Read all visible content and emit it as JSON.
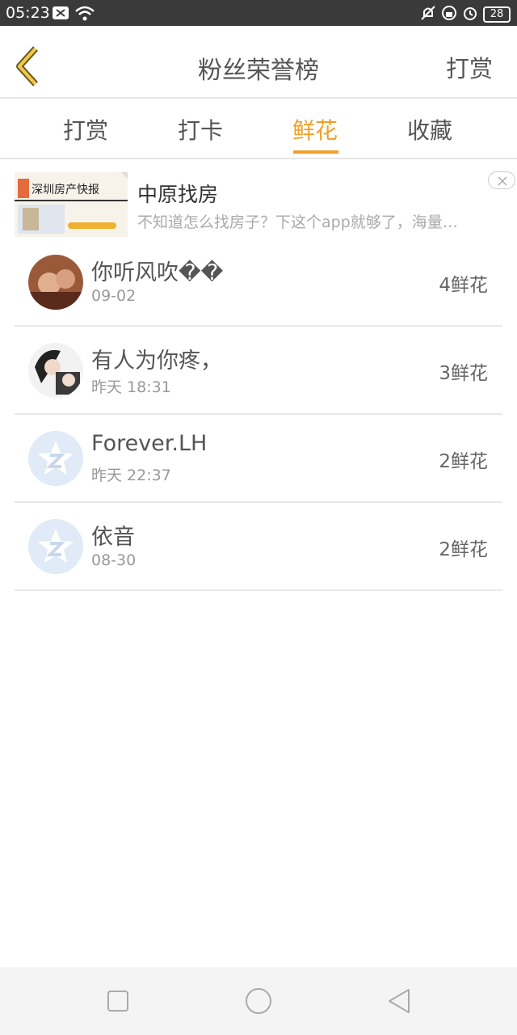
{
  "status": {
    "time": "05:23",
    "battery": "28"
  },
  "header": {
    "title": "粉丝荣誉榜",
    "action": "打赏"
  },
  "tabs": [
    {
      "label": "打赏"
    },
    {
      "label": "打卡"
    },
    {
      "label": "鲜花"
    },
    {
      "label": "收藏"
    }
  ],
  "ad": {
    "title": "中原找房",
    "description": "不知道怎么找房子？下这个app就够了，海量…",
    "image_text": "深圳房产快报"
  },
  "rows": [
    {
      "name": "你听风吹��",
      "date": "09-02",
      "count": "4鲜花"
    },
    {
      "name": "有人为你疼，",
      "date": "昨天 18:31",
      "count": "3鲜花"
    },
    {
      "name": "Forever.LH",
      "date": "昨天 22:37",
      "count": "2鲜花"
    },
    {
      "name": "依音",
      "date": "08-30",
      "count": "2鲜花"
    }
  ],
  "colors": {
    "accent": "#f0a028",
    "text": "#555555",
    "secondary": "#999999"
  }
}
